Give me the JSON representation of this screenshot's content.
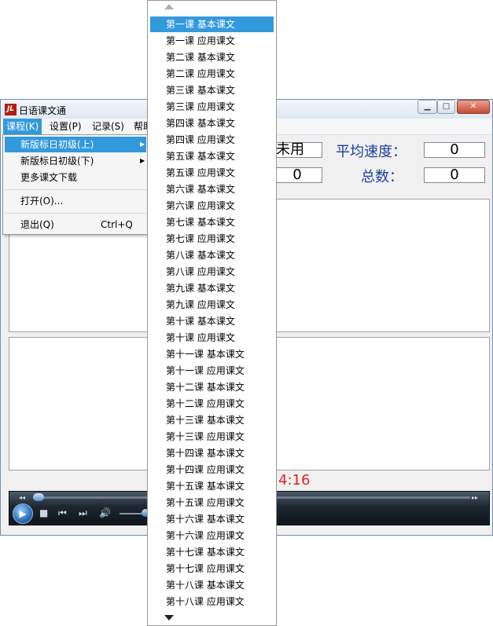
{
  "window": {
    "title": "日语课文通",
    "app_icon_text": "JL"
  },
  "menubar": {
    "items": [
      "课程(K)",
      "设置(P)",
      "记录(S)",
      "帮助"
    ]
  },
  "stats": {
    "elapsed_value": "未用",
    "avg_speed_label": "平均速度：",
    "avg_speed_value": "0",
    "second_value": "0",
    "total_label": "总数：",
    "total_value": "0"
  },
  "timer": {
    "display": "4:16"
  },
  "course_menu": {
    "items": [
      {
        "label": "新版标日初级(上)",
        "submenu": true,
        "highlighted": true
      },
      {
        "label": "新版标日初级(下)",
        "submenu": true
      },
      {
        "label": "更多课文下载"
      },
      {
        "label": "打开(O)..."
      },
      {
        "label": "退出(Q)",
        "shortcut": "Ctrl+Q"
      }
    ]
  },
  "lessons": [
    "第一课 基本课文",
    "第一课 应用课文",
    "第二课 基本课文",
    "第二课 应用课文",
    "第三课 基本课文",
    "第三课 应用课文",
    "第四课 基本课文",
    "第四课 应用课文",
    "第五课 基本课文",
    "第五课 应用课文",
    "第六课 基本课文",
    "第六课 应用课文",
    "第七课 基本课文",
    "第七课 应用课文",
    "第八课 基本课文",
    "第八课 应用课文",
    "第九课 基本课文",
    "第九课 应用课文",
    "第十课 基本课文",
    "第十课 应用课文",
    "第十一课 基本课文",
    "第十一课 应用课文",
    "第十二课 基本课文",
    "第十二课 应用课文",
    "第十三课 基本课文",
    "第十三课 应用课文",
    "第十四课 基本课文",
    "第十四课 应用课文",
    "第十五课 基本课文",
    "第十五课 应用课文",
    "第十六课 基本课文",
    "第十六课 应用课文",
    "第十七课 基本课文",
    "第十七课 应用课文",
    "第十八课 基本课文",
    "第十八课 应用课文"
  ],
  "selected_lesson": "第一课 基本课文",
  "colors": {
    "highlight": "#3399dd",
    "label_blue": "#1c3f9c",
    "timer_red": "#e02020"
  }
}
